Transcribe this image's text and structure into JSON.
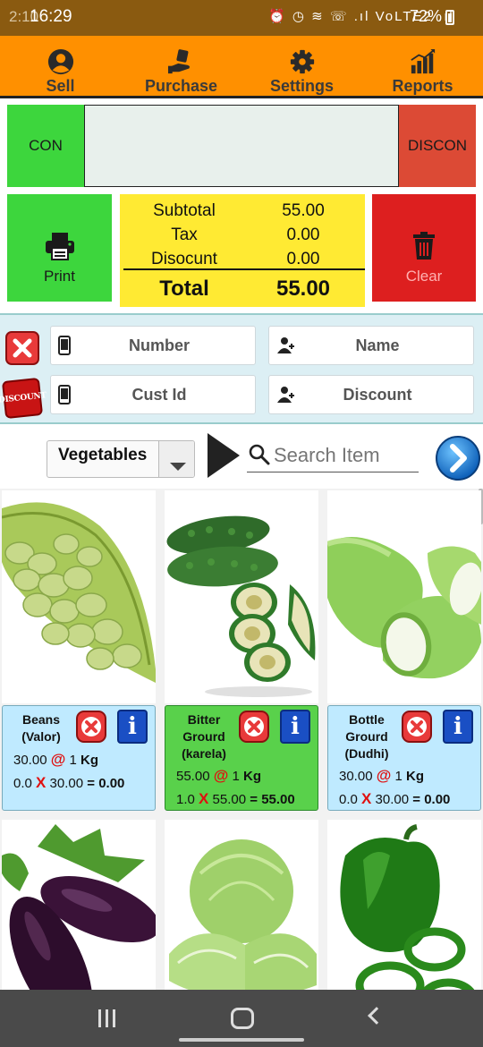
{
  "status_bar": {
    "ghost_time": "2:10",
    "time": "16:29",
    "icons": "⏰ ◷ ≋ ☏ .ıl VoLTE2 .ıl",
    "battery": "72%"
  },
  "nav": {
    "sell": "Sell",
    "purchase": "Purchase",
    "settings": "Settings",
    "reports": "Reports"
  },
  "connection": {
    "con_label": "CON",
    "discon_label": "DISCON"
  },
  "actions": {
    "print_label": "Print",
    "clear_label": "Clear"
  },
  "totals": {
    "subtotal_label": "Subtotal",
    "subtotal_value": "55.00",
    "tax_label": "Tax",
    "tax_value": "0.00",
    "discount_label": "Disocunt",
    "discount_value": "0.00",
    "total_label": "Total",
    "total_value": "55.00"
  },
  "customer": {
    "number_placeholder": "Number",
    "name_placeholder": "Name",
    "cust_id_placeholder": "Cust Id",
    "discount_placeholder": "Discount",
    "discount_badge": "DISCOUNT"
  },
  "filter": {
    "category": "Vegetables",
    "search_placeholder": "Search Item"
  },
  "products": [
    {
      "name": "Beans (Valor)",
      "price": "30.00",
      "at": "@",
      "qty_unit": "1",
      "unit": "Kg",
      "qty": "0.0",
      "x": "X",
      "rate": "30.00",
      "eq": "=",
      "amount": "0.00",
      "selected": false
    },
    {
      "name": "Bitter Grourd (karela)",
      "price": "55.00",
      "at": "@",
      "qty_unit": "1",
      "unit": "Kg",
      "qty": "1.0",
      "x": "X",
      "rate": "55.00",
      "eq": "=",
      "amount": "55.00",
      "selected": true
    },
    {
      "name": "Bottle Grourd (Dudhi)",
      "price": "30.00",
      "at": "@",
      "qty_unit": "1",
      "unit": "Kg",
      "qty": "0.0",
      "x": "X",
      "rate": "30.00",
      "eq": "=",
      "amount": "0.00",
      "selected": false
    }
  ],
  "colors": {
    "nav_bar": "#ff9000",
    "status_bar": "#8a5a10",
    "con_green": "#3dd63d",
    "discon_red": "#dc4a35",
    "totals_yellow": "#ffea33",
    "clear_red": "#dd1f1f",
    "card_blue": "#bfeaff",
    "card_selected_green": "#59d14b"
  }
}
